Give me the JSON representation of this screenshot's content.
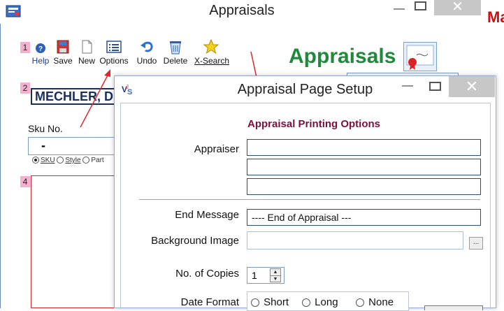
{
  "main_window": {
    "title": "Appraisals",
    "brand_title": "Appraisals",
    "markers": [
      "1",
      "2",
      "4"
    ],
    "toolbar": [
      {
        "label": "Help",
        "icon": "help-icon"
      },
      {
        "label": "Save",
        "icon": "save-icon"
      },
      {
        "label": "New",
        "icon": "new-document-icon"
      },
      {
        "label": "Options",
        "icon": "options-list-icon"
      },
      {
        "label": "Undo",
        "icon": "undo-icon"
      },
      {
        "label": "Delete",
        "icon": "delete-bin-icon"
      },
      {
        "label": "X-Search",
        "icon": "star-search-icon"
      }
    ],
    "customer_name": "MECHLER, D",
    "sku_label": "Sku No.",
    "sku_value": "-",
    "search_modes": [
      {
        "label": "SKU",
        "selected": true
      },
      {
        "label": "Style",
        "selected": false
      },
      {
        "label": "Part",
        "selected": false
      }
    ],
    "peek_text": "Ma"
  },
  "dialog": {
    "title": "Appraisal Page Setup",
    "section_title": "Appraisal Printing Options",
    "appraiser_label": "Appraiser",
    "appraiser_lines": [
      "",
      "",
      ""
    ],
    "end_message_label": "End Message",
    "end_message_value": "---- End of Appraisal ---",
    "background_image_label": "Background Image",
    "background_image_value": "",
    "browse_label": "...",
    "copies_label": "No. of Copies",
    "copies_value": "1",
    "date_format_label": "Date Format",
    "date_formats": [
      {
        "label": "Short",
        "selected": false
      },
      {
        "label": "Long",
        "selected": false
      },
      {
        "label": "None",
        "selected": false
      }
    ]
  },
  "colors": {
    "brand_green": "#1f8a3a",
    "section_maroon": "#7b0f3f",
    "annotation_red": "#e0262b",
    "marker_pink": "#f4b0cf"
  }
}
